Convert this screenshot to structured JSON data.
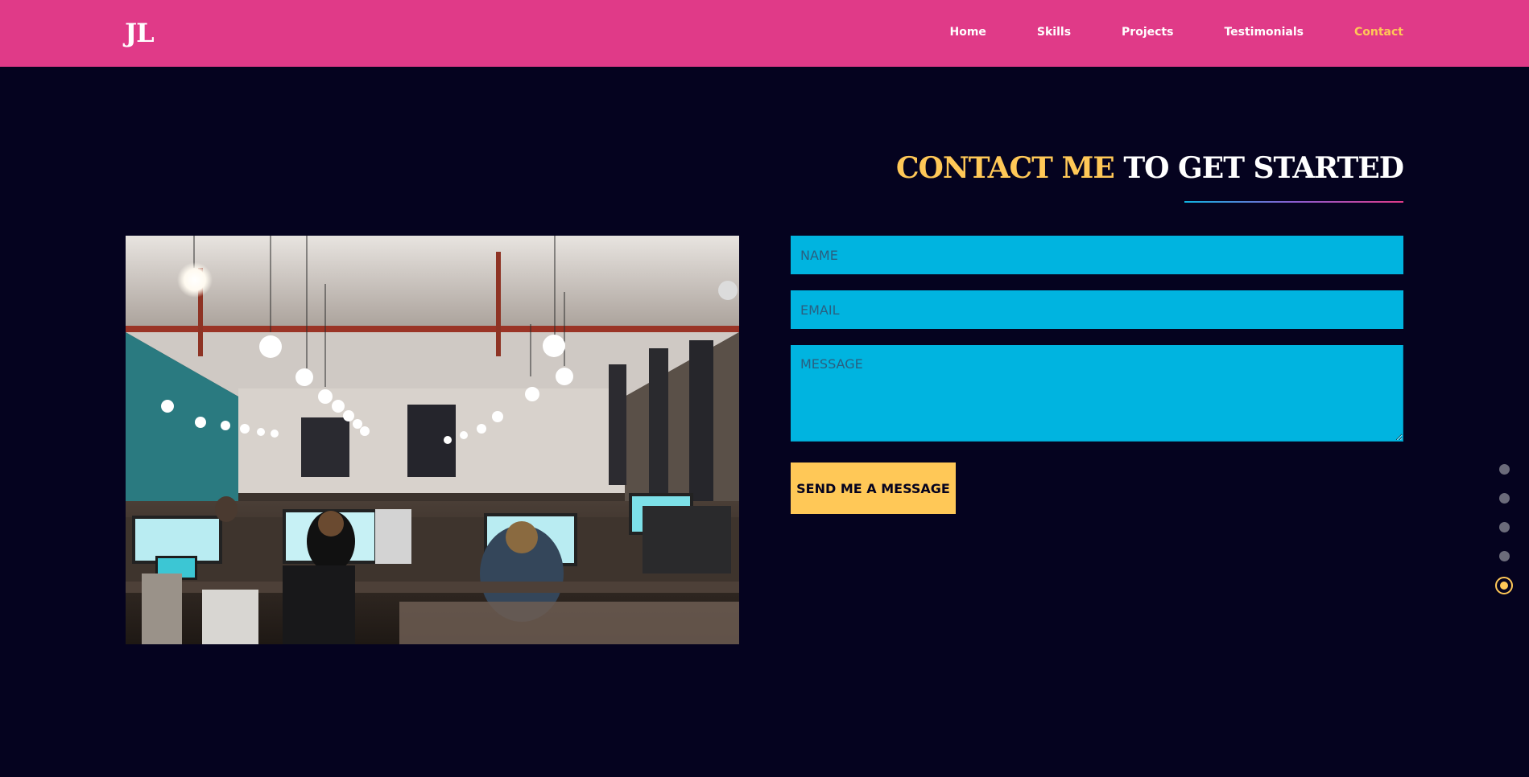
{
  "brand": {
    "logo": "JL"
  },
  "nav": {
    "items": [
      {
        "label": "Home"
      },
      {
        "label": "Skills"
      },
      {
        "label": "Projects"
      },
      {
        "label": "Testimonials"
      },
      {
        "label": "Contact",
        "active": true
      }
    ]
  },
  "contact": {
    "heading_accent": "CONTACT ME",
    "heading_rest": " TO GET STARTED",
    "name_placeholder": "NAME",
    "email_placeholder": "EMAIL",
    "message_placeholder": "MESSAGE",
    "submit_label": "SEND ME A MESSAGE",
    "image_alt": "office-photo"
  },
  "section_nav": {
    "total": 5,
    "active_index": 4
  },
  "colors": {
    "navbar": "#e03a88",
    "background": "#05031f",
    "accent": "#ffc857",
    "field": "#00b4e0"
  }
}
